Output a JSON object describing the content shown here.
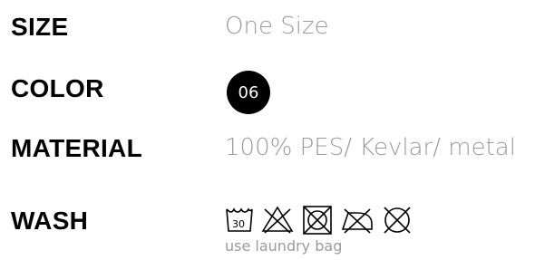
{
  "size": {
    "label": "SIZE",
    "value": "One Size"
  },
  "color": {
    "label": "COLOR",
    "swatch_text": "06",
    "swatch_color": "#000000"
  },
  "material": {
    "label": "MATERIAL",
    "value": "100% PES/ Kevlar/ metal"
  },
  "wash": {
    "label": "WASH",
    "icons": [
      "wash-30-icon",
      "do-not-bleach-icon",
      "do-not-tumble-dry-icon",
      "do-not-iron-icon",
      "do-not-dry-clean-icon"
    ],
    "wash_temperature": "30",
    "note": "use laundry bag"
  }
}
